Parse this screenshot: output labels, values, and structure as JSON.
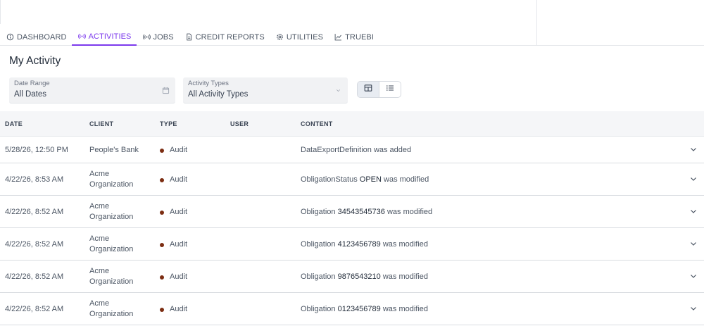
{
  "nav": {
    "tabs": [
      {
        "label": "DASHBOARD",
        "icon": "info-circle-icon",
        "active": false
      },
      {
        "label": "ACTIVITIES",
        "icon": "broadcast-icon",
        "active": true
      },
      {
        "label": "JOBS",
        "icon": "broadcast-icon",
        "active": false
      },
      {
        "label": "CREDIT REPORTS",
        "icon": "document-icon",
        "active": false
      },
      {
        "label": "UTILITIES",
        "icon": "gear-icon",
        "active": false
      },
      {
        "label": "TRUEBI",
        "icon": "line-chart-icon",
        "active": false
      }
    ],
    "accent_color": "#7c3aed"
  },
  "page": {
    "title": "My Activity"
  },
  "filters": {
    "date_range": {
      "label": "Date Range",
      "value": "All Dates",
      "icon": "calendar-icon"
    },
    "activity_types": {
      "label": "Activity Types",
      "value": "All Activity Types",
      "icon": "chevron-down-icon"
    }
  },
  "view_toggle": {
    "options": [
      "grid-view-icon",
      "list-view-icon"
    ],
    "selected": "grid-view-icon"
  },
  "table": {
    "columns": [
      "DATE",
      "CLIENT",
      "TYPE",
      "USER",
      "CONTENT"
    ],
    "type_dot_color": "#7c2d12",
    "rows": [
      {
        "date": "5/28/26, 12:50 PM",
        "client": "People's Bank",
        "type": "Audit",
        "user": "",
        "content_pre": "DataExportDefinition was added",
        "content_bold": "",
        "content_post": ""
      },
      {
        "date": "4/22/26, 8:53 AM",
        "client": "Acme Organization",
        "type": "Audit",
        "user": "",
        "content_pre": "ObligationStatus ",
        "content_bold": "OPEN",
        "content_post": " was modified"
      },
      {
        "date": "4/22/26, 8:52 AM",
        "client": "Acme Organization",
        "type": "Audit",
        "user": "",
        "content_pre": "Obligation ",
        "content_bold": "34543545736",
        "content_post": " was modified"
      },
      {
        "date": "4/22/26, 8:52 AM",
        "client": "Acme Organization",
        "type": "Audit",
        "user": "",
        "content_pre": "Obligation ",
        "content_bold": "4123456789",
        "content_post": " was modified"
      },
      {
        "date": "4/22/26, 8:52 AM",
        "client": "Acme Organization",
        "type": "Audit",
        "user": "",
        "content_pre": "Obligation ",
        "content_bold": "9876543210",
        "content_post": " was modified"
      },
      {
        "date": "4/22/26, 8:52 AM",
        "client": "Acme Organization",
        "type": "Audit",
        "user": "",
        "content_pre": "Obligation ",
        "content_bold": "0123456789",
        "content_post": " was modified"
      }
    ]
  }
}
